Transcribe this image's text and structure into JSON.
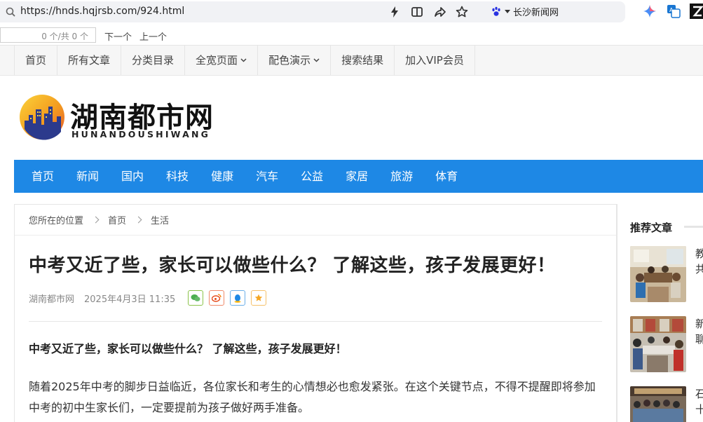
{
  "browser": {
    "url": "https://hnds.hqjrsb.com/924.html",
    "search_engine_label": "长沙新闻网",
    "find": {
      "count": "0 个/共 0 个",
      "next": "下一个",
      "prev": "上一个"
    }
  },
  "top_nav": [
    "首页",
    "所有文章",
    "分类目录",
    "全宽页面",
    "配色演示",
    "搜索结果",
    "加入VIP会员"
  ],
  "logo": {
    "title": "湖南都市网",
    "subtitle": "HUNANDOUSHIWANG"
  },
  "main_nav": [
    "首页",
    "新闻",
    "国内",
    "科技",
    "健康",
    "汽车",
    "公益",
    "家居",
    "旅游",
    "体育"
  ],
  "breadcrumb": {
    "prefix": "您所在的位置",
    "home": "首页",
    "category": "生活"
  },
  "article": {
    "title": "中考又近了些，家长可以做些什么？ 了解这些，孩子发展更好！",
    "source": "湖南都市网",
    "date": "2025年4月3日 11:35",
    "lead": "中考又近了些，家长可以做些什么？ 了解这些，孩子发展更好！",
    "paragraph": "随着2025年中考的脚步日益临近，各位家长和考生的心情想必也愈发紧张。在这个关键节点，不得不提醒即将参加中考的初中生家长们，一定要提前为孩子做好两手准备。"
  },
  "sidebar": {
    "title": "推荐文章",
    "items": [
      {
        "text": "教共"
      },
      {
        "text": "新聊"
      },
      {
        "text": "石十"
      }
    ]
  },
  "colors": {
    "nav_blue": "#1e88e5",
    "wechat": "#4caf50",
    "weibo": "#e64a19",
    "qq": "#1e88e5",
    "favorite": "#f5a623"
  }
}
